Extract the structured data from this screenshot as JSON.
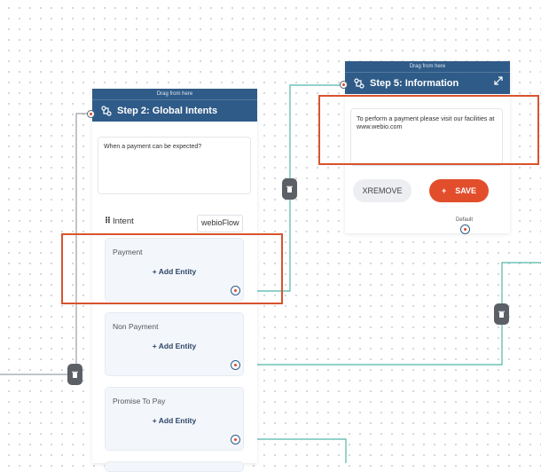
{
  "nodes": {
    "step2": {
      "drag_label": "Drag from here",
      "title": "Step 2: Global Intents",
      "question_text": "When a payment can be expected?",
      "intent_label": "Intent",
      "intent_value": "webioFlow",
      "cards": [
        {
          "label": "Payment",
          "action": "+ Add Entity"
        },
        {
          "label": "Non Payment",
          "action": "+ Add Entity"
        },
        {
          "label": "Promise To Pay",
          "action": "+ Add Entity"
        }
      ]
    },
    "step5": {
      "drag_label": "Drag from here",
      "title": "Step 5: Information",
      "message_text": "To perform a payment please visit our facilities at www.webio.com",
      "remove_label": "XREMOVE",
      "save_plus": "+",
      "save_label": "SAVE",
      "default_label": "Default"
    }
  },
  "colors": {
    "header": "#2f5b88",
    "accent": "#e24e2c",
    "connector": "#4fb8a8",
    "trash": "#5b5f66",
    "highlight": "#d9532e"
  },
  "icons": [
    "flow-icon",
    "expand-icon",
    "trash-icon",
    "port-icon",
    "target-icon"
  ]
}
